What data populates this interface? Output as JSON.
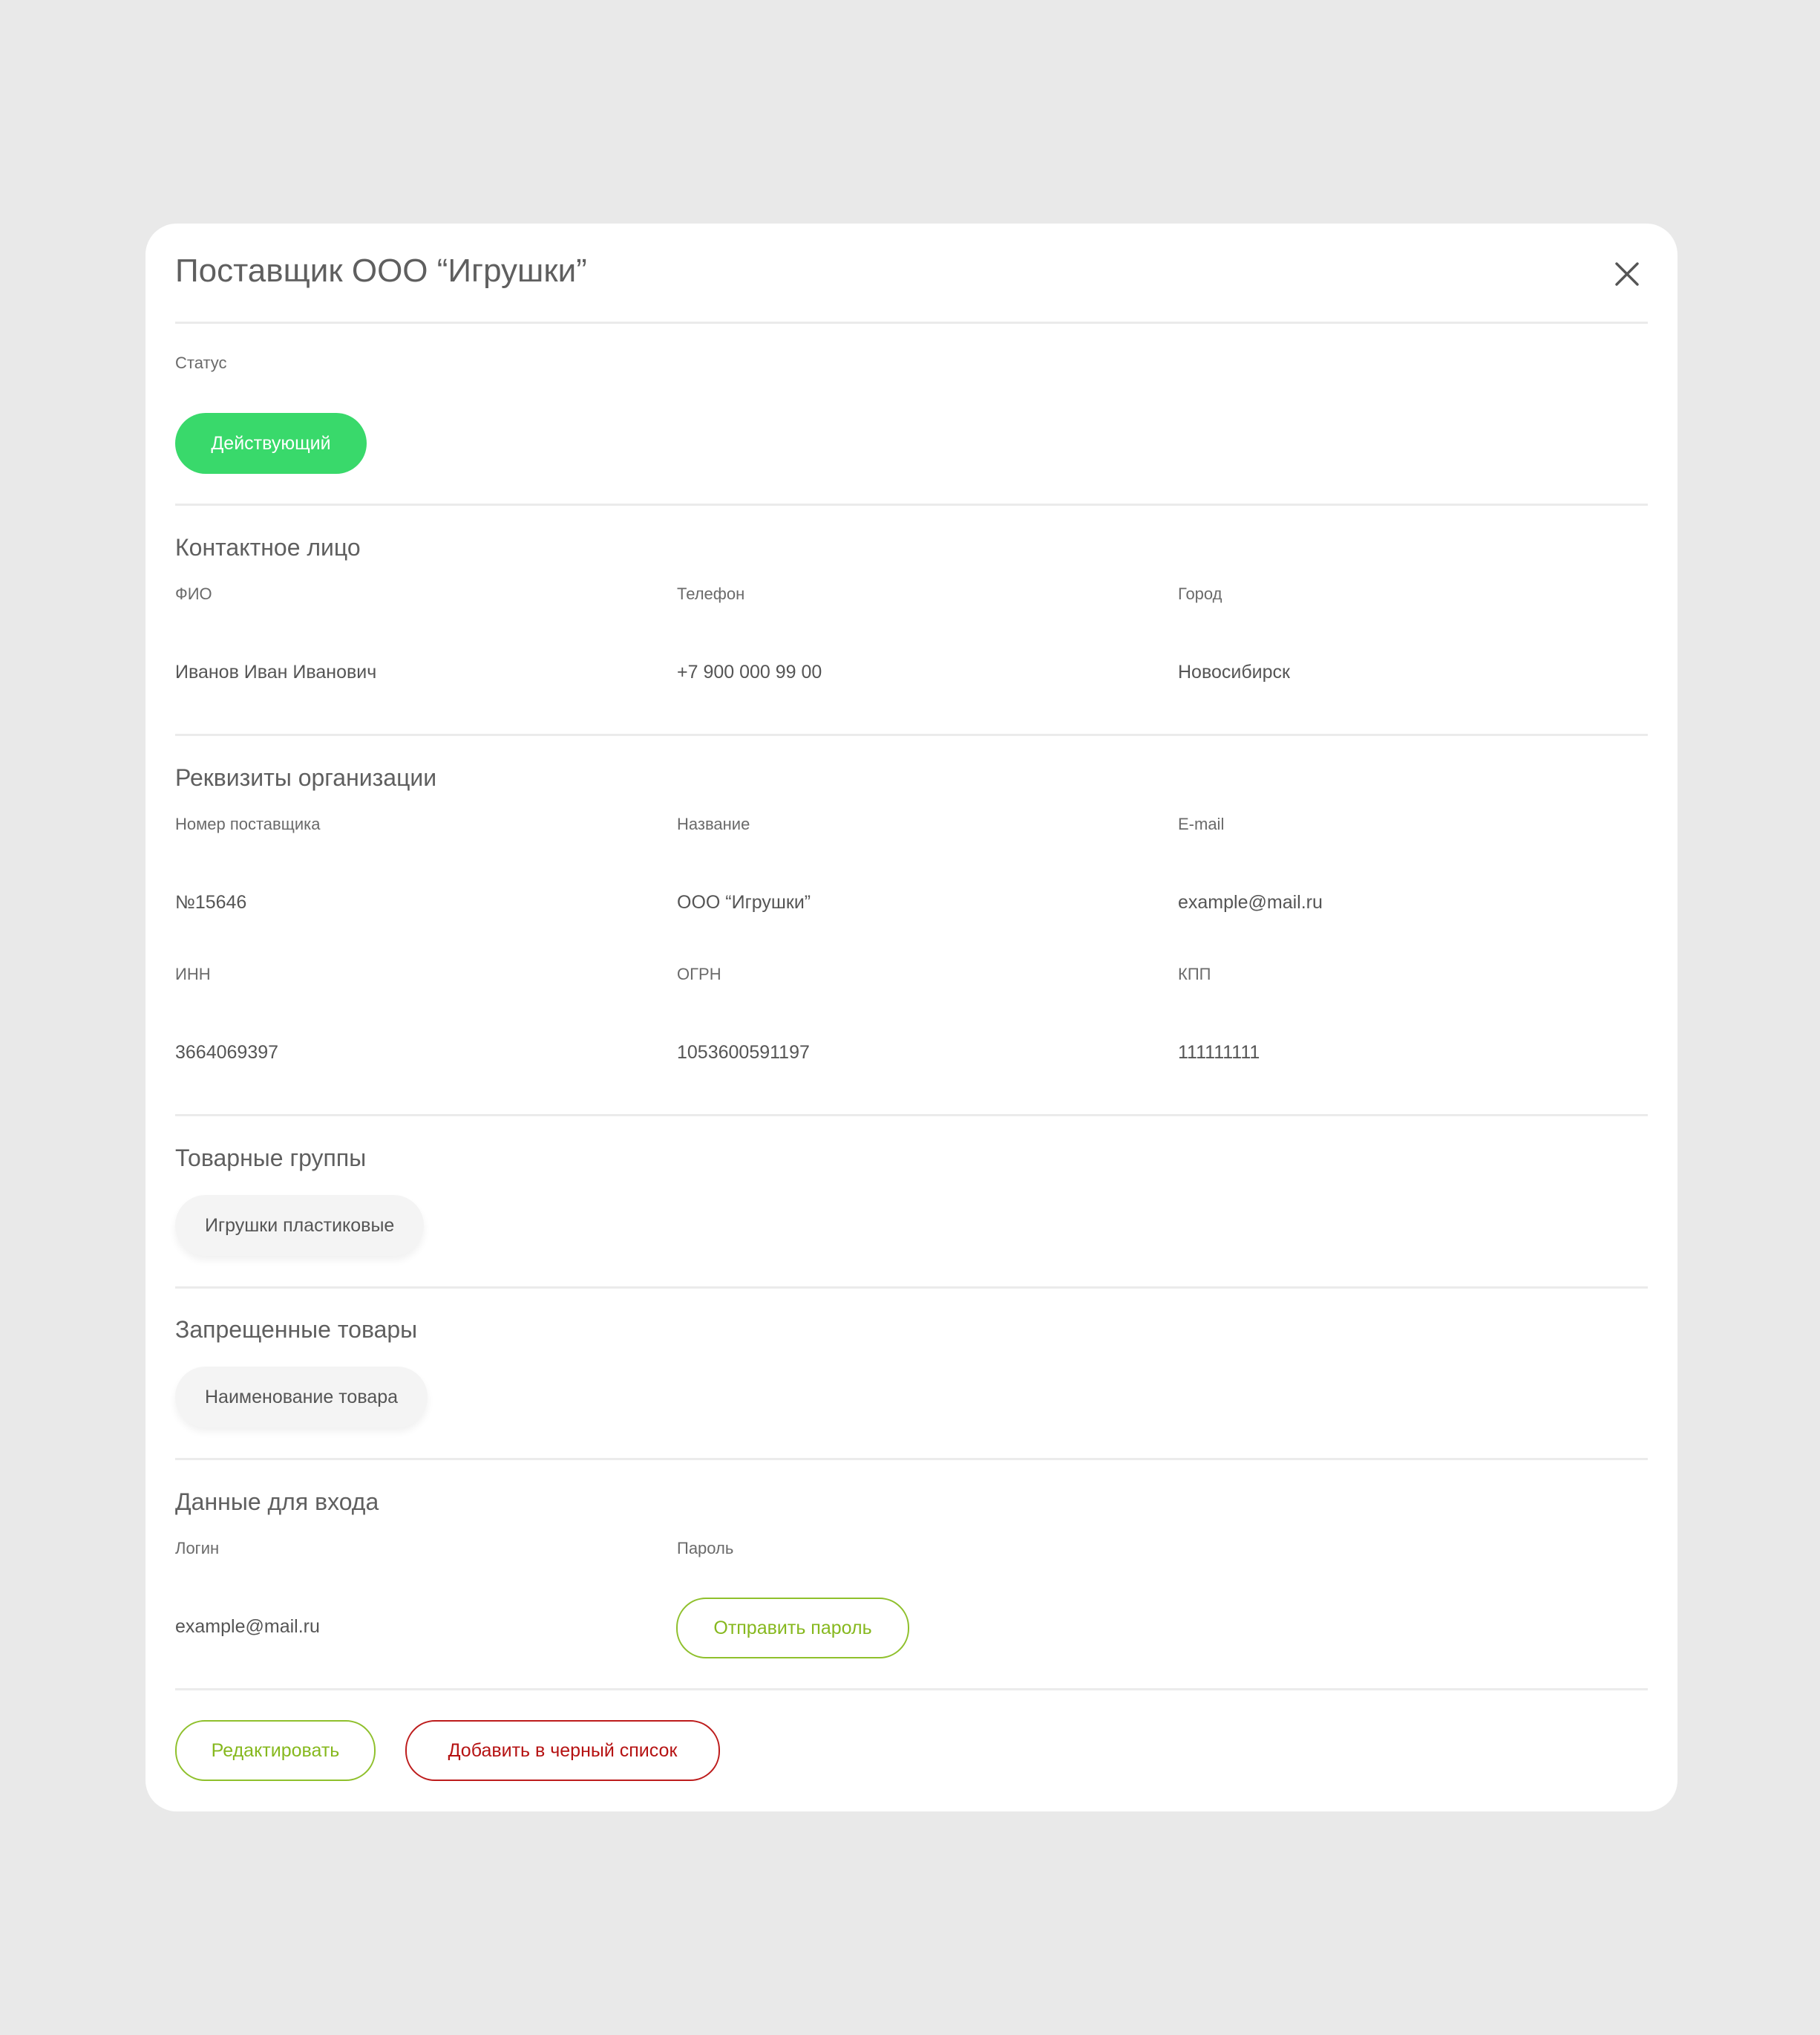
{
  "modal": {
    "title": "Поставщик ООО “Игрушки”",
    "close_icon": "close-icon"
  },
  "status": {
    "label": "Статус",
    "value": "Действующий",
    "color": "#39d96b"
  },
  "contact": {
    "title": "Контактное лицо",
    "fields": [
      {
        "label": "ФИО",
        "value": "Иванов Иван Иванович"
      },
      {
        "label": "Телефон",
        "value": "+7 900 000 99 00"
      },
      {
        "label": "Город",
        "value": "Новосибирск"
      }
    ]
  },
  "requisites": {
    "title": "Реквизиты организации",
    "fields": [
      {
        "label": "Номер поставщика",
        "value": "№15646"
      },
      {
        "label": "Название",
        "value": "ООО “Игрушки”"
      },
      {
        "label": "E-mail",
        "value": "example@mail.ru"
      },
      {
        "label": "ИНН",
        "value": "3664069397"
      },
      {
        "label": "ОГРН",
        "value": "1053600591197"
      },
      {
        "label": "КПП",
        "value": "111111111"
      }
    ]
  },
  "product_groups": {
    "title": "Товарные группы",
    "items": [
      "Игрушки пластиковые"
    ]
  },
  "forbidden_goods": {
    "title": "Запрещенные товары",
    "items": [
      "Наименование товара"
    ]
  },
  "login_data": {
    "title": "Данные для входа",
    "login_label": "Логин",
    "login_value": "example@mail.ru",
    "password_label": "Пароль",
    "send_password_label": "Отправить пароль"
  },
  "actions": {
    "edit_label": "Редактировать",
    "blacklist_label": "Добавить в черный список",
    "accent_green": "#86b81e",
    "accent_red": "#b51212"
  }
}
